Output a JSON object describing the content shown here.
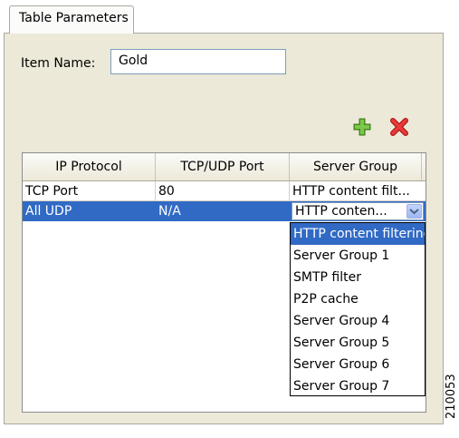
{
  "tab": {
    "label": "Table Parameters"
  },
  "item_name": {
    "label": "Item Name:",
    "value": "Gold"
  },
  "toolbar": {
    "add_icon": "plus-icon",
    "delete_icon": "x-icon"
  },
  "table": {
    "columns": [
      "IP Protocol",
      "TCP/UDP Port",
      "Server Group"
    ],
    "rows": [
      {
        "protocol": "TCP Port",
        "port": "80",
        "server_group": "HTTP content filt..."
      },
      {
        "protocol": "All UDP",
        "port": "N/A",
        "server_group": "HTTP conten..."
      }
    ]
  },
  "dropdown": {
    "options": [
      "HTTP content filtering",
      "Server Group 1",
      "SMTP filter",
      "P2P cache",
      "Server Group 4",
      "Server Group 5",
      "Server Group 6",
      "Server Group 7"
    ],
    "selected_index": 0
  },
  "figure_id": "210053",
  "colors": {
    "selection": "#316ac5",
    "add_icon": "#5aa02c",
    "delete_icon": "#d81f1f"
  }
}
